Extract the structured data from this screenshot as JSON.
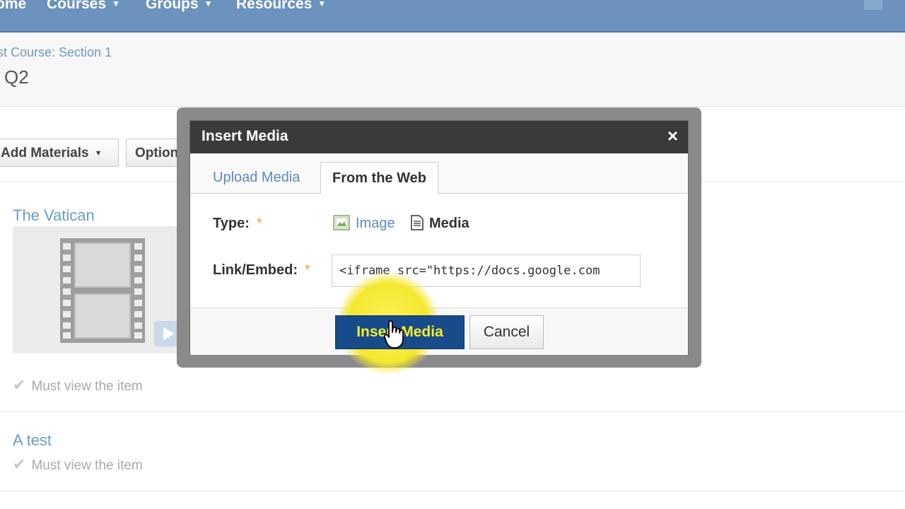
{
  "nav": {
    "items": [
      {
        "label": "ome",
        "caret": ""
      },
      {
        "label": "Courses",
        "caret": "▼"
      },
      {
        "label": "Groups",
        "caret": "▼"
      },
      {
        "label": "Resources",
        "caret": "▼"
      }
    ]
  },
  "header": {
    "breadcrumb": "st Course: Section 1",
    "title": "Q2"
  },
  "toolbar": {
    "add_materials": "Add Materials",
    "options": "Options"
  },
  "items": [
    {
      "title": "The Vatican",
      "requirement": "Must view the item"
    },
    {
      "title": "A test",
      "requirement": "Must view the item"
    }
  ],
  "modal": {
    "title": "Insert Media",
    "close": "×",
    "tabs": {
      "upload": "Upload Media",
      "web": "From the Web"
    },
    "type_label": "Type:",
    "required_mark": "*",
    "type_options": {
      "image": "Image",
      "media": "Media"
    },
    "link_label": "Link/Embed:",
    "link_value": "<iframe src=\"https://docs.google.com",
    "insert_button": "Insert Media",
    "cancel_button": "Cancel"
  }
}
